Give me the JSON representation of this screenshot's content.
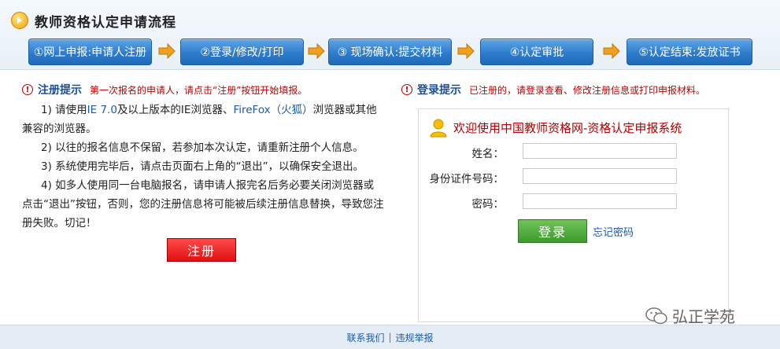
{
  "header": {
    "title": "教师资格认定申请流程",
    "steps": [
      {
        "label": "①网上申报:申请人注册"
      },
      {
        "label": "②登录/修改/打印"
      },
      {
        "label": "③ 现场确认:提交材料"
      },
      {
        "label": "④认定审批"
      },
      {
        "label": "⑤认定结束:发放证书"
      }
    ]
  },
  "register": {
    "alert_label": "注册提示",
    "alert_text": "第一次报名的申请人，请点击“注册”按钮开始填报。",
    "p1_a": "1) 请使用",
    "p1_ie": "IE 7.0",
    "p1_b": "及以上版本的IE浏览器、",
    "p1_ff": "FireFox（火狐）",
    "p1_c": "浏览器或其他兼容的浏览器。",
    "p2": "2) 以往的报名信息不保留，若参加本次认定，请重新注册个人信息。",
    "p3": "3) 系统使用完毕后，请点击页面右上角的“退出”，以确保安全退出。",
    "p4": "4) 如多人使用同一台电脑报名，请申请人报完名后务必要关闭浏览器或点击“退出”按钮，否则，您的注册信息将可能被后续注册信息替换，导致您注册失败。切记！",
    "button_label": "注册"
  },
  "login": {
    "alert_label": "登录提示",
    "alert_text": "已注册的，请登录查看、修改注册信息或打印申报材料。",
    "welcome": "欢迎使用中国教师资格网-资格认定申报系统",
    "name_label": "姓名：",
    "id_label": "身份证件号码：",
    "password_label": "密码：",
    "name_value": "",
    "id_value": "",
    "password_value": "",
    "button_label": "登录",
    "forgot_label": "忘记密码"
  },
  "watermark": {
    "text": "弘正学苑"
  },
  "footer": {
    "contact": "联系我们",
    "separator": "|",
    "report": "违规举报"
  },
  "colors": {
    "step_blue": "#2e7ccd",
    "arrow_orange": "#f0a020",
    "alert_red": "#c00000",
    "link_blue": "#1b5aa8",
    "login_green": "#3e9a2b"
  }
}
